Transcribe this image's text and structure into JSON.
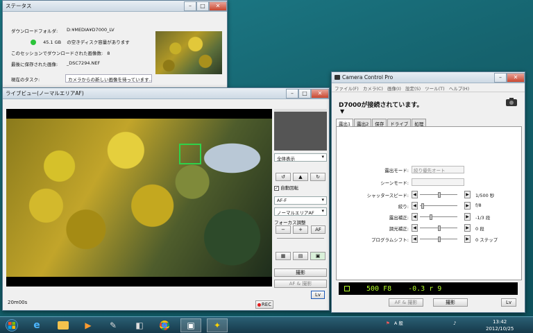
{
  "status_window": {
    "title": "ステータス",
    "download_folder_label": "ダウンロードフォルダ:",
    "download_folder_value": "D:¥MEDIA¥D7000_LV",
    "disk_space": "45.1 GB",
    "disk_space_suffix": "の空きディスク容量があります",
    "session_count_label": "このセッションでダウンロードされた画像数:",
    "session_count_value": "8",
    "last_image_label": "最後に保存された画像:",
    "last_image_value": "_DSC7294.NEF",
    "current_task_label": "現在のタスク:",
    "current_task_value": "カメラからの新しい画像を待っています..."
  },
  "liveview_window": {
    "title": "ライブビュー(ノーマルエリアAF)",
    "display_select": "全体表示",
    "auto_rotate_label": "自動回転",
    "af_mode_select": "AF-F",
    "af_area_select": "ノーマルエリアAF",
    "focus_adjust_label": "フォーカス調整",
    "focus_minus": "−",
    "focus_plus": "+",
    "af_button": "AF",
    "shoot_button": "撮影",
    "af_shoot_button": "AF & 撮影",
    "lv_button": "Lv",
    "elapsed": "20m00s",
    "rec_button": "REC"
  },
  "ccp_window": {
    "title": "Camera Control Pro",
    "menu": [
      "ファイル(F)",
      "カメラ(C)",
      "画像(I)",
      "設定(S)",
      "ツール(T)",
      "ヘルプ(H)"
    ],
    "header": "D7000が接続されています。",
    "tabs": [
      "露出1",
      "露出2",
      "保存",
      "ドライブ",
      "処理"
    ],
    "rows": [
      {
        "label": "露出モード:",
        "value": "絞り優先オート"
      },
      {
        "label": "シーンモード:",
        "value": ""
      },
      {
        "label": "シャッタースピード:",
        "value": "1/500 秒"
      },
      {
        "label": "絞り:",
        "value": "f/8"
      },
      {
        "label": "露出補正:",
        "value": "-1/3 段"
      },
      {
        "label": "調光補正:",
        "value": "0 段"
      },
      {
        "label": "プログラムシフト:",
        "value": "0 ステップ"
      }
    ],
    "lcd_text": "500 F8",
    "lcd_right": "-0.3 r 9",
    "af_shoot_button": "AF & 撮影",
    "shoot_button": "撮影",
    "lv_button": "Lv"
  },
  "taskbar": {
    "tray_text": "A 般",
    "clock_time": "13:42",
    "clock_date": "2012/10/25"
  }
}
